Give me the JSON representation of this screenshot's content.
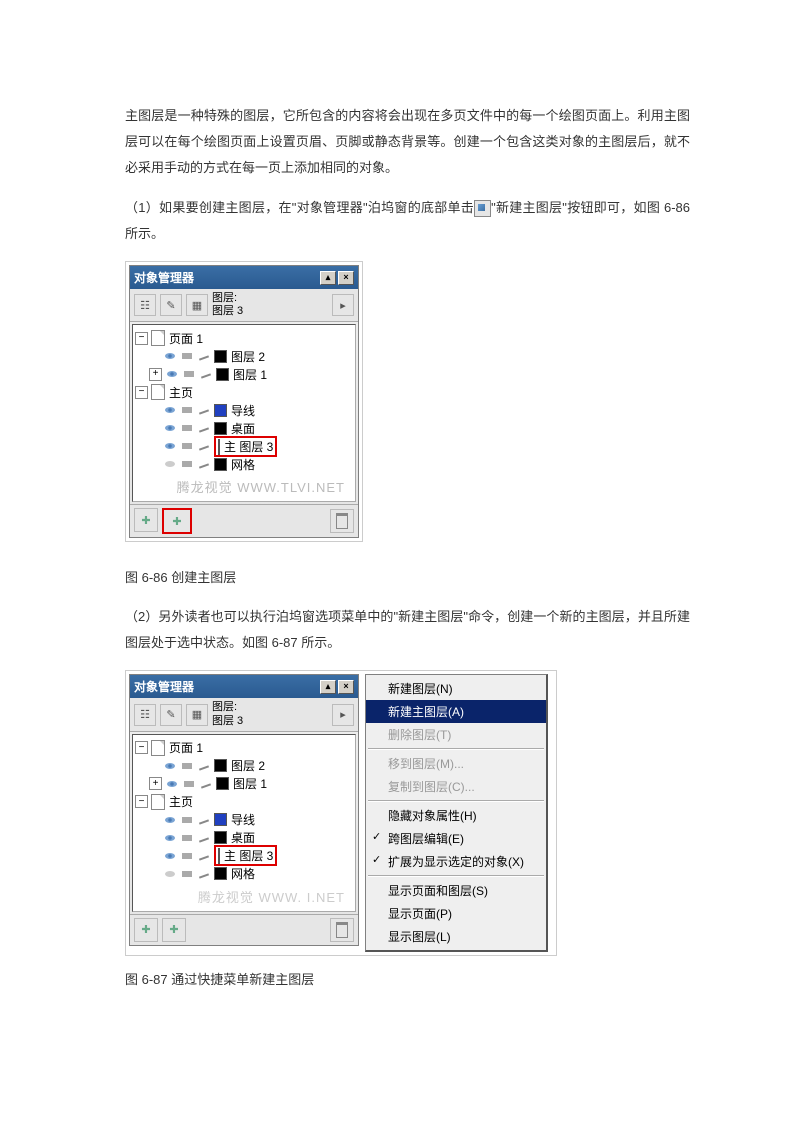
{
  "paragraphs": {
    "intro": "主图层是一种特殊的图层，它所包含的内容将会出现在多页文件中的每一个绘图页面上。利用主图层可以在每个绘图页面上设置页眉、页脚或静态背景等。创建一个包含这类对象的主图层后，就不必采用手动的方式在每一页上添加相同的对象。",
    "step1_a": "（1）如果要创建主图层，在\"对象管理器\"泊坞窗的底部单击",
    "step1_b": "\"新建主图层\"按钮即可，如图 6-86 所示。",
    "step2": "（2）另外读者也可以执行泊坞窗选项菜单中的\"新建主图层\"命令，创建一个新的主图层，并且所建图层处于选中状态。如图 6-87 所示。"
  },
  "captions": {
    "fig1": "图 6-86   创建主图层",
    "fig2": "图 6-87   通过快捷菜单新建主图层"
  },
  "panel": {
    "title": "对象管理器",
    "layer_label_top": "图层:",
    "layer_label_bottom": "图层 3",
    "page1": "页面 1",
    "layer2": "图层 2",
    "layer1": "图层 1",
    "master": "主页",
    "guides": "导线",
    "desktop": "桌面",
    "master_layer3": "主  图层 3",
    "grid": "网格",
    "watermark": "腾龙视觉 WWW.TLVI.NET"
  },
  "menu": {
    "new_layer": "新建图层(N)",
    "new_master": "新建主图层(A)",
    "delete_layer": "删除图层(T)",
    "move_to": "移到图层(M)...",
    "copy_to": "复制到图层(C)...",
    "hide_props": "隐藏对象属性(H)",
    "cross_edit": "跨图层编辑(E)",
    "expand_sel": "扩展为显示选定的对象(X)",
    "show_page_layer": "显示页面和图层(S)",
    "show_page": "显示页面(P)",
    "show_layer": "显示图层(L)"
  },
  "watermark2": "腾龙视觉 WWW.          I.NET"
}
